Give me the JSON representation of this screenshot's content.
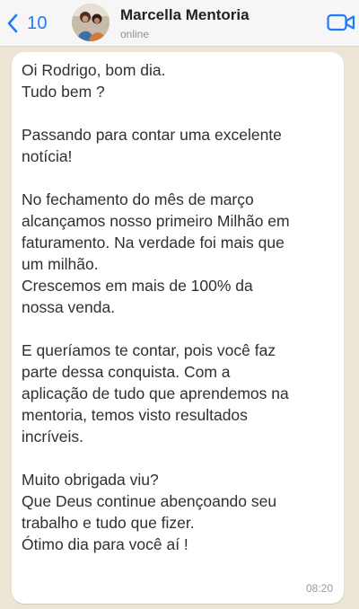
{
  "header": {
    "back_count": "10",
    "contact_name": "Marcella Mentoria",
    "status": "online"
  },
  "icons": {
    "back": "chevron-left-icon",
    "avatar": "contact-photo",
    "video": "video-call-icon"
  },
  "colors": {
    "accent": "#1f7cf6",
    "chat_background": "#ece4d4",
    "bubble": "#ffffff",
    "header": "#f6f6f6"
  },
  "message": {
    "lines": [
      "Oi Rodrigo, bom dia.",
      "Tudo bem ?",
      "",
      "Passando para contar uma excelente",
      "notícia!",
      "",
      "No fechamento do mês de março",
      "alcançamos nosso primeiro Milhão em",
      "faturamento. Na verdade foi mais que",
      "um milhão.",
      "Crescemos em mais de 100% da",
      "nossa venda.",
      "",
      "E queríamos te contar, pois você faz",
      "parte dessa conquista. Com a",
      "aplicação de tudo que aprendemos na",
      "mentoria, temos visto resultados",
      "incríveis.",
      "",
      "Muito obrigada viu?",
      "Que Deus continue abençoando seu",
      "trabalho e tudo que fizer.",
      "Ótimo dia para você aí !"
    ],
    "time": "08:20"
  }
}
